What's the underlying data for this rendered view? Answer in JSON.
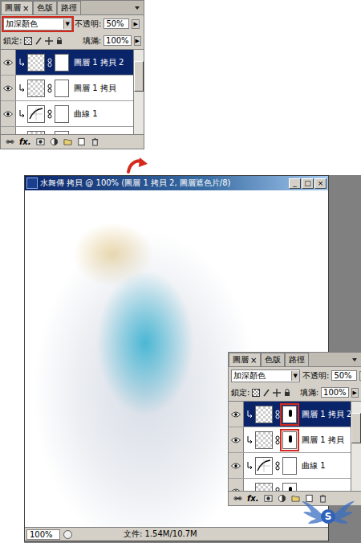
{
  "window": {
    "title": "水舞傳 拷貝 @ 100% (圖層 1 拷貝 2, 圖層遮色片/8)",
    "controls": [
      "_",
      "□",
      "×"
    ],
    "zoom": "100%",
    "doc_info": "文件: 1.54M/10.7M"
  },
  "panels": [
    {
      "tabs": [
        {
          "label": "圖層",
          "close": "×",
          "selected": true
        },
        {
          "label": "色版",
          "close": "",
          "selected": false
        },
        {
          "label": "路徑",
          "close": "",
          "selected": false
        }
      ],
      "blend_mode": "加深顏色",
      "blend_highlighted": true,
      "dropdown_arrow": "▼",
      "step_arrow": "▶",
      "opacity_label": "不透明:",
      "opacity": "50%",
      "lock_label": "鎖定:",
      "fill_label": "填滿:",
      "fill": "100%",
      "fx": "fx.",
      "layers": [
        {
          "name": "圖層 1 拷貝 2",
          "kind": "pixel",
          "visible": true,
          "selected": true,
          "clipped": true,
          "mask_highlighted": false,
          "mask_marks": false
        },
        {
          "name": "圖層 1 拷貝",
          "kind": "pixel",
          "visible": true,
          "selected": false,
          "clipped": true,
          "mask_highlighted": false,
          "mask_marks": false
        },
        {
          "name": "曲線 1",
          "kind": "curves",
          "visible": true,
          "selected": false,
          "clipped": true,
          "mask_highlighted": false,
          "mask_marks": false
        },
        {
          "name": "",
          "kind": "pixel",
          "visible": true,
          "selected": false,
          "clipped": false,
          "mask_highlighted": false,
          "mask_marks": true
        }
      ]
    },
    {
      "tabs": [
        {
          "label": "圖層",
          "close": "×",
          "selected": true
        },
        {
          "label": "色版",
          "close": "",
          "selected": false
        },
        {
          "label": "路徑",
          "close": "",
          "selected": false
        }
      ],
      "blend_mode": "加深顏色",
      "blend_highlighted": false,
      "dropdown_arrow": "▼",
      "step_arrow": "▶",
      "opacity_label": "不透明:",
      "opacity": "50%",
      "lock_label": "鎖定:",
      "fill_label": "填滿:",
      "fill": "100%",
      "fx": "fx.",
      "layers": [
        {
          "name": "圖層 1 拷貝 2",
          "kind": "pixel",
          "visible": true,
          "selected": true,
          "clipped": true,
          "mask_highlighted": true,
          "mask_marks": true
        },
        {
          "name": "圖層 1 拷貝",
          "kind": "pixel",
          "visible": true,
          "selected": false,
          "clipped": true,
          "mask_highlighted": true,
          "mask_marks": true
        },
        {
          "name": "曲線 1",
          "kind": "curves",
          "visible": true,
          "selected": false,
          "clipped": true,
          "mask_highlighted": false,
          "mask_marks": false
        },
        {
          "name": "",
          "kind": "pixel",
          "visible": true,
          "selected": false,
          "clipped": false,
          "mask_highlighted": false,
          "mask_marks": true
        }
      ]
    }
  ],
  "watermark": {
    "mark": "S"
  }
}
